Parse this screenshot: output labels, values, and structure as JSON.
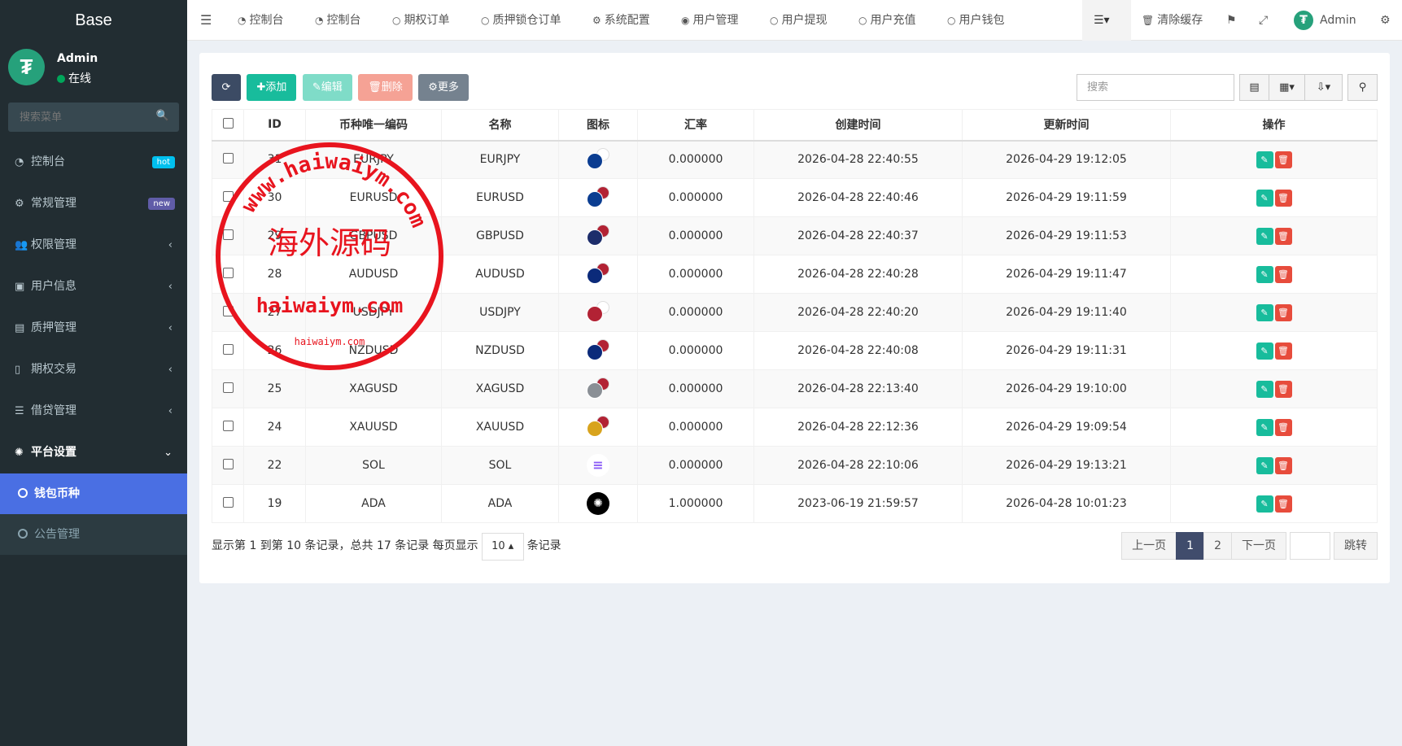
{
  "sidebar": {
    "logo": "Base",
    "user_name": "Admin",
    "user_status": "在线",
    "search_placeholder": "搜索菜单",
    "items": [
      {
        "label": "控制台",
        "badge": "hot",
        "badge_color": "#00c0ef"
      },
      {
        "label": "常规管理",
        "badge": "new",
        "badge_color": "#605ca8"
      },
      {
        "label": "权限管理"
      },
      {
        "label": "用户信息"
      },
      {
        "label": "质押管理"
      },
      {
        "label": "期权交易"
      },
      {
        "label": "借贷管理"
      },
      {
        "label": "平台设置"
      }
    ],
    "sub_items": [
      {
        "label": "钱包币种",
        "active": true
      },
      {
        "label": "公告管理"
      }
    ]
  },
  "topbar": {
    "tabs": [
      "控制台",
      "控制台",
      "期权订单",
      "质押锁仓订单",
      "系统配置",
      "用户管理",
      "用户提现",
      "用户充值",
      "用户钱包"
    ],
    "clear_cache": "清除缓存",
    "admin": "Admin"
  },
  "toolbar": {
    "buttons": [
      {
        "label": "",
        "color": "#3c4b64"
      },
      {
        "label": "添加",
        "color": "#18bc9c"
      },
      {
        "label": "编辑",
        "color": "#7fdcc8"
      },
      {
        "label": "删除",
        "color": "#f59a8c"
      },
      {
        "label": "更多",
        "color": "#75828f"
      }
    ],
    "search_placeholder": "搜索"
  },
  "table": {
    "headers": [
      "ID",
      "币种唯一编码",
      "名称",
      "图标",
      "汇率",
      "创建时间",
      "更新时间",
      "操作"
    ],
    "rows": [
      {
        "id": "31",
        "code": "EURJPY",
        "name": "EURJPY",
        "rate": "0.000000",
        "created": "2026-04-28 22:40:55",
        "updated": "2026-04-29 19:12:05",
        "icon": "eu-jp"
      },
      {
        "id": "30",
        "code": "EURUSD",
        "name": "EURUSD",
        "rate": "0.000000",
        "created": "2026-04-28 22:40:46",
        "updated": "2026-04-29 19:11:59",
        "icon": "eu-us"
      },
      {
        "id": "29",
        "code": "GBPUSD",
        "name": "GBPUSD",
        "rate": "0.000000",
        "created": "2026-04-28 22:40:37",
        "updated": "2026-04-29 19:11:53",
        "icon": "gb-us"
      },
      {
        "id": "28",
        "code": "AUDUSD",
        "name": "AUDUSD",
        "rate": "0.000000",
        "created": "2026-04-28 22:40:28",
        "updated": "2026-04-29 19:11:47",
        "icon": "au-us"
      },
      {
        "id": "27",
        "code": "USDJPY",
        "name": "USDJPY",
        "rate": "0.000000",
        "created": "2026-04-28 22:40:20",
        "updated": "2026-04-29 19:11:40",
        "icon": "us-jp"
      },
      {
        "id": "26",
        "code": "NZDUSD",
        "name": "NZDUSD",
        "rate": "0.000000",
        "created": "2026-04-28 22:40:08",
        "updated": "2026-04-29 19:11:31",
        "icon": "nz-us"
      },
      {
        "id": "25",
        "code": "XAGUSD",
        "name": "XAGUSD",
        "rate": "0.000000",
        "created": "2026-04-28 22:13:40",
        "updated": "2026-04-29 19:10:00",
        "icon": "silver-us"
      },
      {
        "id": "24",
        "code": "XAUUSD",
        "name": "XAUUSD",
        "rate": "0.000000",
        "created": "2026-04-28 22:12:36",
        "updated": "2026-04-29 19:09:54",
        "icon": "gold-us"
      },
      {
        "id": "22",
        "code": "SOL",
        "name": "SOL",
        "rate": "0.000000",
        "created": "2026-04-28 22:10:06",
        "updated": "2026-04-29 19:13:21",
        "icon": "sol"
      },
      {
        "id": "19",
        "code": "ADA",
        "name": "ADA",
        "rate": "1.000000",
        "created": "2023-06-19 21:59:57",
        "updated": "2026-04-28 10:01:23",
        "icon": "ada"
      }
    ]
  },
  "footer": {
    "info_prefix": "显示第 1 到第 10 条记录，总共 17 条记录 每页显示",
    "per_page": "10",
    "info_suffix": "条记录",
    "prev": "上一页",
    "page1": "1",
    "page2": "2",
    "next": "下一页",
    "jump": "跳转"
  },
  "watermark": {
    "ring_text": "www.haiwaiym.com",
    "center_text": "海外源码",
    "domain_text": "haiwaiym.com",
    "small_text": "haiwaiym.com"
  }
}
